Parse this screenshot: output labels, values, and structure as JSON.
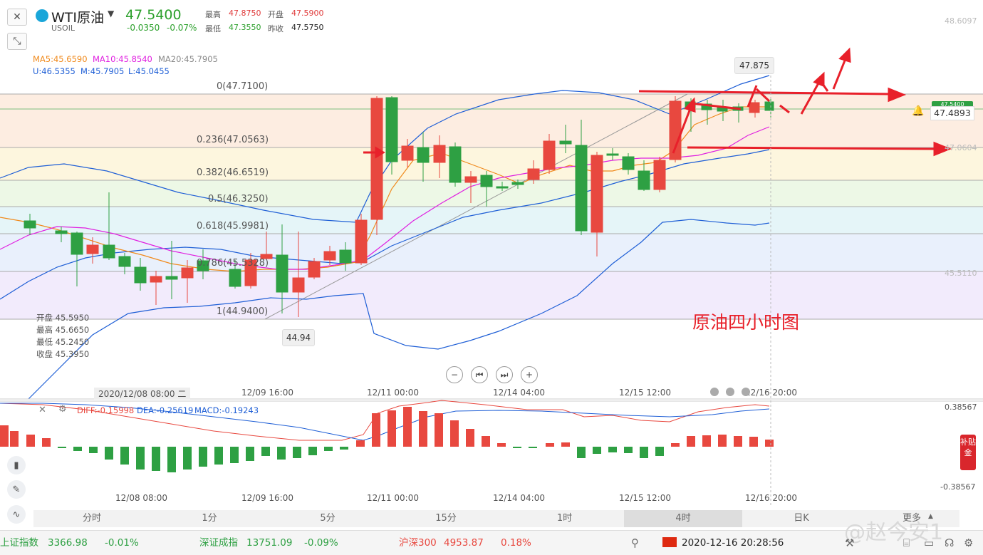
{
  "header": {
    "symbol": "WTI原油",
    "code": "USOIL",
    "price": "47.5400",
    "change": "-0.0350",
    "change_pct": "-0.07%",
    "high_label": "最高",
    "high": "47.8750",
    "open_label": "开盘",
    "open": "47.5900",
    "low_label": "最低",
    "low": "47.3550",
    "prev_label": "昨收",
    "prev_close": "47.5750"
  },
  "ma": {
    "ma5": "MA5:45.6590",
    "ma10": "MA10:45.8540",
    "ma20": "MA20:45.7905",
    "upper": "U:46.5355",
    "mid": "M:45.7905",
    "lower": "L:45.0455"
  },
  "fib_labels": [
    "0(47.7100)",
    "0.236(47.0563)",
    "0.382(46.6519)",
    "0.5(46.3250)",
    "0.618(45.9981)",
    "0.786(45.5328)",
    "1(44.9400)"
  ],
  "right_axis": [
    "48.6097",
    "47.0604",
    "45.5110"
  ],
  "current_price_tag": "47.4893",
  "current_price_badge": "47.5400",
  "peak_tag": "47.875",
  "low_tag": "44.94",
  "ohlc_info": {
    "open": "开盘 45.5950",
    "high": "最高 45.6650",
    "low": "最低 45.2450",
    "close": "收盘 45.3950"
  },
  "annotation": "原油四小时图",
  "x_axis": [
    "2020/12/08 08:00 二",
    "12/09 16:00",
    "12/11 00:00",
    "12/14 04:00",
    "12/15 12:00",
    "12/16 20:00"
  ],
  "x_axis_lower": [
    "12/08 08:00",
    "12/09 16:00",
    "12/11 00:00",
    "12/14 04:00",
    "12/15 12:00",
    "12/16 20:00"
  ],
  "macd": {
    "diff": "DIFF:-0.15998",
    "dea": "DEA:-0.25619",
    "macd": "MACD:-0.19243",
    "top": "0.38567",
    "bottom": "-0.38567"
  },
  "tabs": [
    "分时",
    "1分",
    "5分",
    "15分",
    "1时",
    "4时",
    "日K",
    "更多"
  ],
  "active_tab": "4时",
  "side_badge": "补贴金",
  "ticker": {
    "sh_name": "上证指数",
    "sh_val": "3366.98",
    "sh_pct": "-0.01%",
    "sz_name": "深证成指",
    "sz_val": "13751.09",
    "sz_pct": "-0.09%",
    "hs_name": "沪深300",
    "hs_val": "4953.87",
    "hs_pct": "0.18%",
    "datetime": "2020-12-16 20:28:56"
  },
  "watermark": "@赵今安1",
  "colors": {
    "up": "#e8483f",
    "down": "#2ea043",
    "accent_blue": "#1f5fd6",
    "magenta": "#e020e0",
    "orange": "#f08a1c"
  }
}
